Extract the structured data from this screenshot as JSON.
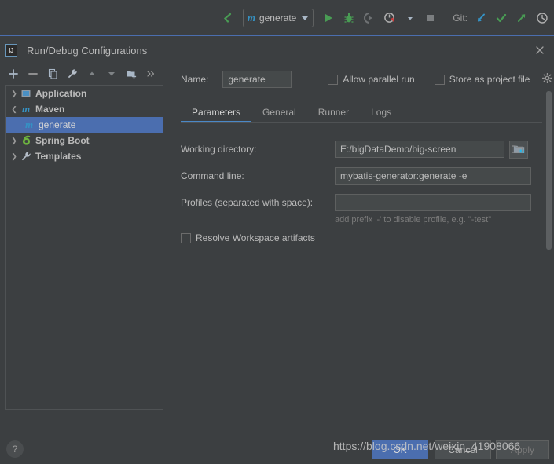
{
  "ide_toolbar": {
    "back_icon": "back-arrow-icon",
    "run_config": {
      "maven_glyph": "m",
      "name": "generate",
      "dropdown_icon": "chevron-down-icon"
    },
    "run_icon": "run-play-icon",
    "debug_icon": "debug-bug-icon",
    "run_with_coverage_icon": "run-coverage-icon",
    "profiler_icon": "profiler-icon",
    "profiler_dropdown_icon": "chevron-down-icon",
    "stop_icon": "stop-square-icon",
    "git_label": "Git:",
    "git_update_icon": "git-update-arrow-icon",
    "git_commit_icon": "git-commit-check-icon",
    "git_push_icon": "git-push-arrow-icon",
    "git_history_icon": "git-history-clock-icon"
  },
  "dialog": {
    "app_icon": "intellij-idea-logo-icon",
    "title": "Run/Debug Configurations",
    "close_icon": "close-icon"
  },
  "tree_toolbar": {
    "add_icon": "plus-icon",
    "remove_icon": "minus-icon",
    "copy_icon": "copy-icon",
    "edit_templates_icon": "wrench-icon",
    "move_up_icon": "arrow-up-icon",
    "move_down_icon": "arrow-down-icon",
    "new_folder_icon": "new-folder-icon",
    "more_icon": "chevron-double-right-icon"
  },
  "tree": {
    "items": [
      {
        "label": "Application",
        "icon": "application-icon",
        "twisty": "collapsed",
        "indent": 0,
        "selected": false
      },
      {
        "label": "Maven",
        "icon": "maven-icon",
        "twisty": "expanded",
        "indent": 0,
        "selected": false
      },
      {
        "label": "generate",
        "icon": "maven-icon",
        "twisty": "none",
        "indent": 1,
        "selected": true
      },
      {
        "label": "Spring Boot",
        "icon": "spring-boot-icon",
        "twisty": "collapsed",
        "indent": 0,
        "selected": false
      },
      {
        "label": "Templates",
        "icon": "wrench-icon",
        "twisty": "collapsed",
        "indent": 0,
        "selected": false
      }
    ]
  },
  "form": {
    "name_label": "Name:",
    "name_value": "generate",
    "allow_parallel_run": {
      "label": "Allow parallel run",
      "checked": false
    },
    "store_as_project_file": {
      "label": "Store as project file",
      "checked": false
    },
    "store_gear_icon": "gear-icon",
    "tabs": [
      {
        "label": "Parameters",
        "active": true
      },
      {
        "label": "General",
        "active": false
      },
      {
        "label": "Runner",
        "active": false
      },
      {
        "label": "Logs",
        "active": false
      }
    ],
    "working_directory": {
      "label": "Working directory:",
      "value": "E:/bigDataDemo/big-screen",
      "inline_icon": "folder-icon",
      "browse_icon": "folder-open-icon"
    },
    "command_line": {
      "label": "Command line:",
      "value": "mybatis-generator:generate -e",
      "placeholder": ""
    },
    "profiles": {
      "label": "Profiles (separated with space):",
      "value": "",
      "hint": "add prefix '-' to disable profile, e.g. \"-test\""
    },
    "resolve_workspace_artifacts": {
      "label": "Resolve Workspace artifacts",
      "checked": false
    }
  },
  "footer": {
    "help_label": "?",
    "ok_label": "OK",
    "cancel_label": "Cancel",
    "apply_label": "Apply"
  },
  "watermark": {
    "text": "https://blog.csdn.net/weixin_41908066"
  },
  "colors": {
    "background": "#3c3f41",
    "selection": "#4b6eaf",
    "accent_blue": "#4a88c7",
    "maven_blue": "#3592c4",
    "green": "#499c54",
    "text": "#bbbbbb"
  }
}
